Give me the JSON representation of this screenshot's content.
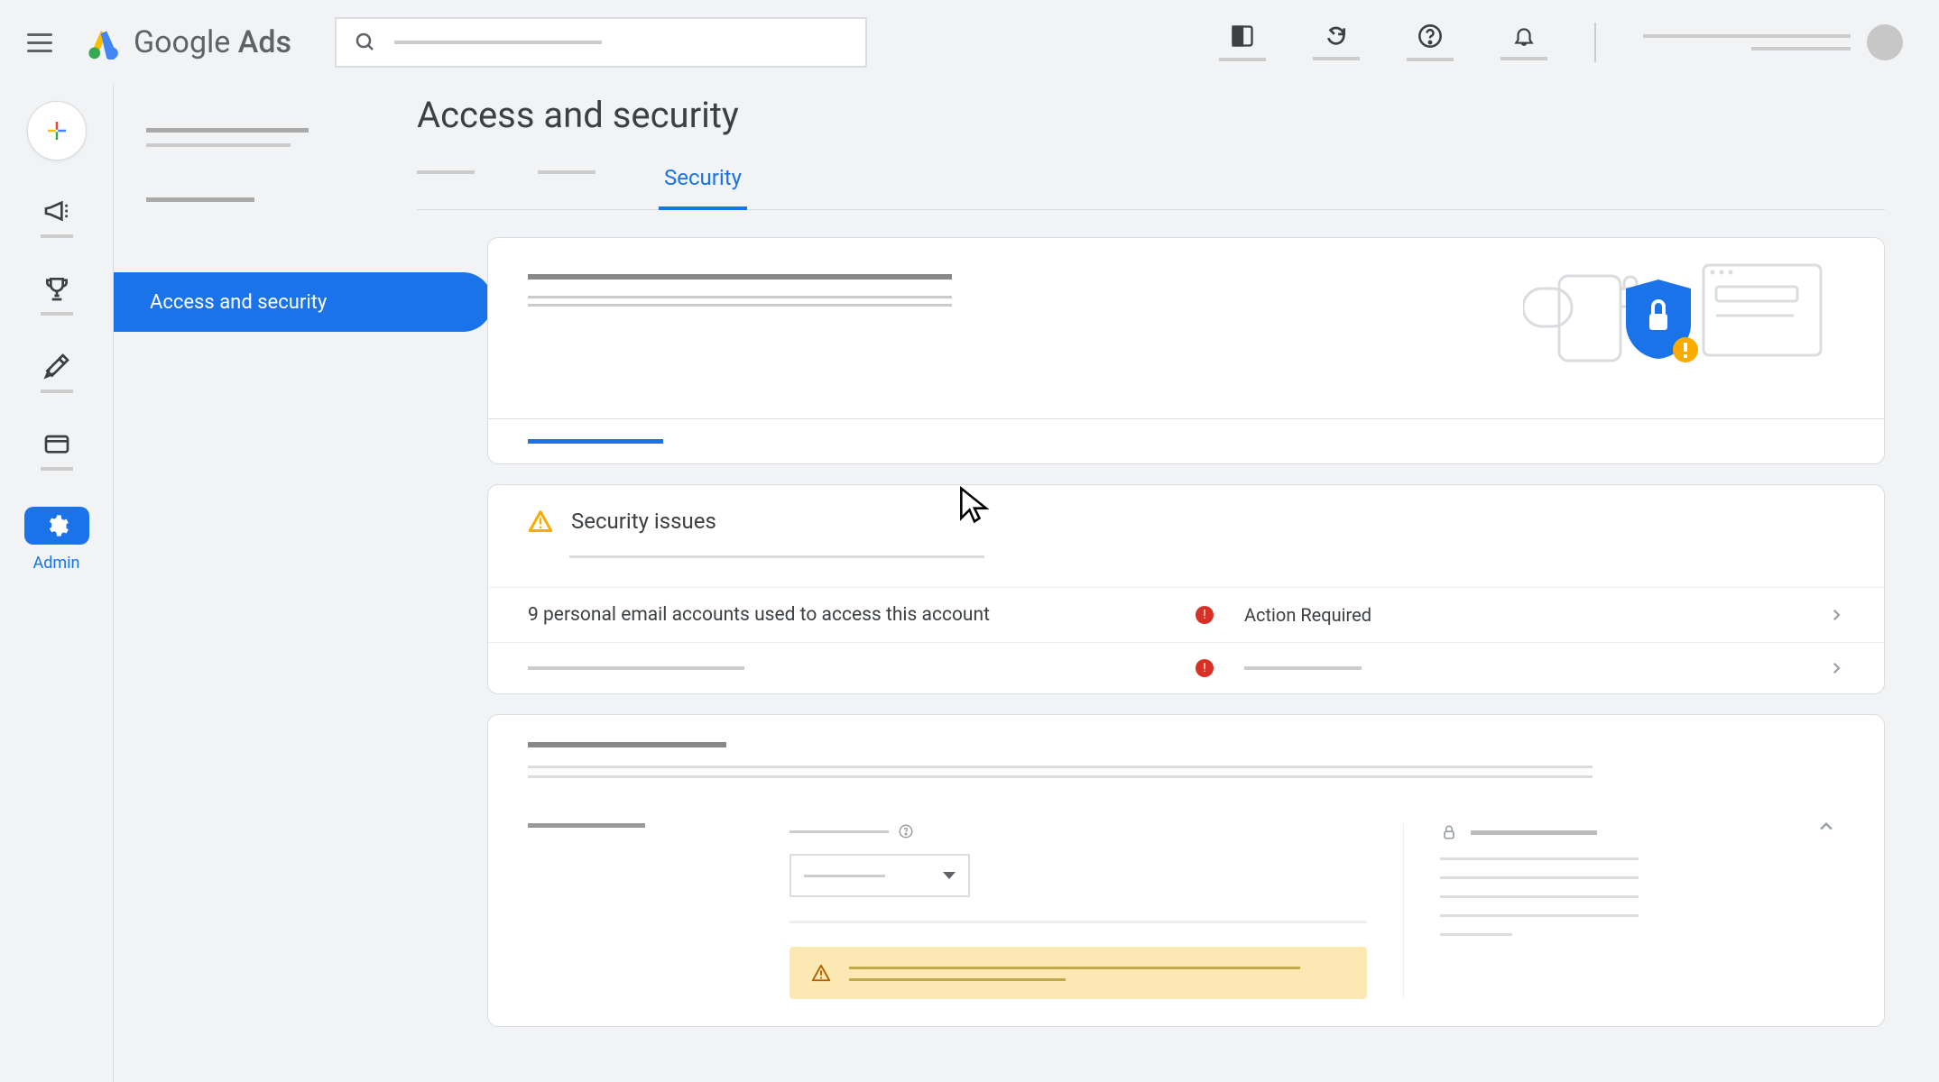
{
  "product": {
    "name": "Google",
    "suffix": "Ads"
  },
  "nav": {
    "admin_label": "Admin",
    "active_item": "Access and security"
  },
  "page": {
    "title": "Access and security",
    "active_tab": "Security"
  },
  "security_issues": {
    "title": "Security issues",
    "issues": [
      {
        "description": "9 personal email accounts used to access this account",
        "status": "Action Required"
      }
    ]
  }
}
